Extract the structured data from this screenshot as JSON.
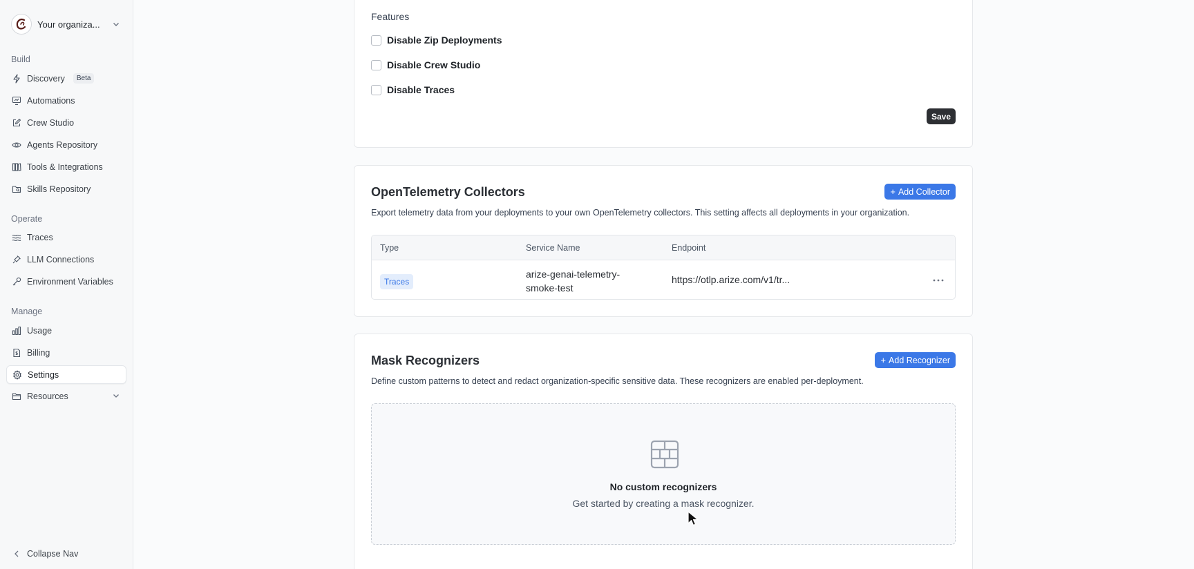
{
  "org": {
    "name": "Your organiza..."
  },
  "nav": {
    "build_label": "Build",
    "operate_label": "Operate",
    "manage_label": "Manage",
    "discovery": "Discovery",
    "discovery_badge": "Beta",
    "automations": "Automations",
    "crew_studio": "Crew Studio",
    "agents_repository": "Agents Repository",
    "tools_integrations": "Tools & Integrations",
    "skills_repository": "Skills Repository",
    "traces": "Traces",
    "llm_connections": "LLM Connections",
    "environment_variables": "Environment Variables",
    "usage": "Usage",
    "billing": "Billing",
    "settings": "Settings",
    "resources": "Resources",
    "collapse": "Collapse Nav",
    "active_item": "Settings"
  },
  "features": {
    "label": "Features",
    "items": [
      {
        "label": "Disable Zip Deployments",
        "checked": false
      },
      {
        "label": "Disable Crew Studio",
        "checked": false
      },
      {
        "label": "Disable Traces",
        "checked": false
      }
    ],
    "save_label": "Save"
  },
  "otel": {
    "title": "OpenTelemetry Collectors",
    "add_label": "Add Collector",
    "description": "Export telemetry data from your deployments to your own OpenTelemetry collectors. This setting affects all deployments in your organization.",
    "columns": {
      "type": "Type",
      "service_name": "Service Name",
      "endpoint": "Endpoint"
    },
    "rows": [
      {
        "type": "Traces",
        "service_name_line1": "arize-genai-telemetry-",
        "service_name_line2": "smoke-test",
        "endpoint": "https://otlp.arize.com/v1/tr..."
      }
    ]
  },
  "mask": {
    "title": "Mask Recognizers",
    "add_label": "Add Recognizer",
    "description": "Define custom patterns to detect and redact organization-specific sensitive data. These recognizers are enabled per-deployment.",
    "empty_title": "No custom recognizers",
    "empty_subtitle": "Get started by creating a mask recognizer."
  },
  "colors": {
    "primary": "#3b78e7",
    "save_bg": "#2d2f33",
    "sidebar_bg": "#f7f8f9"
  }
}
